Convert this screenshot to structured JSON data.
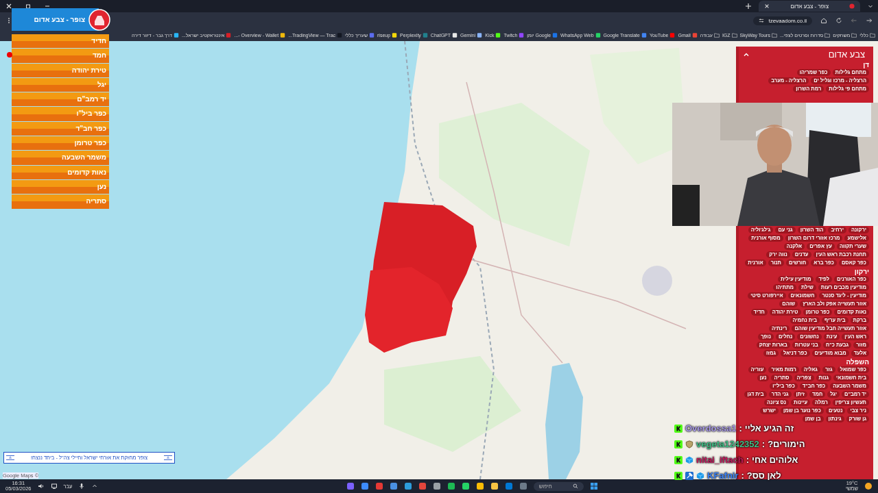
{
  "window": {
    "tab_title": "צופר - צבע אדום",
    "address": "tzevaadom.co.il"
  },
  "bookmarks": [
    {
      "label": "כללי",
      "kind": "folder"
    },
    {
      "label": "משחקים",
      "kind": "folder"
    },
    {
      "label": "סדרות וסרטים לצפי...",
      "kind": "folder"
    },
    {
      "label": "SkyWay Tours",
      "kind": "folder"
    },
    {
      "label": "IGZ",
      "kind": "folder"
    },
    {
      "label": "עבודה",
      "kind": "folder"
    },
    {
      "label": "Gmail",
      "kind": "site",
      "color": "#ea4335"
    },
    {
      "label": "YouTube",
      "kind": "site",
      "color": "#ff0000"
    },
    {
      "label": "Google Translate",
      "kind": "site",
      "color": "#4285f4"
    },
    {
      "label": "WhatsApp Web",
      "kind": "site",
      "color": "#25d366"
    },
    {
      "label": "Google יומן",
      "kind": "site",
      "color": "#1a73e8"
    },
    {
      "label": "Twitch",
      "kind": "site",
      "color": "#9146ff"
    },
    {
      "label": "Kick",
      "kind": "site",
      "color": "#53fc18"
    },
    {
      "label": "Gemini",
      "kind": "site",
      "color": "#8ab4f8"
    },
    {
      "label": "ChatGPT",
      "kind": "site",
      "color": "#e8e8e8"
    },
    {
      "label": "Perplexity",
      "kind": "site",
      "color": "#20808d"
    },
    {
      "label": "riseup",
      "kind": "site",
      "color": "#f5d90a"
    },
    {
      "label": "שעריך כללי",
      "kind": "site",
      "color": "#5b6cf0"
    },
    {
      "label": "TradingView — Trac...",
      "kind": "site",
      "color": "#131722"
    },
    {
      "label": "Overview - Wallet -...",
      "kind": "site",
      "color": "#f0b90b"
    },
    {
      "label": "אינטראקטיב ישראל...",
      "kind": "site",
      "color": "#d81f26"
    },
    {
      "label": "דרך גבר - דיוור דירה",
      "kind": "site",
      "color": "#29b6f6"
    }
  ],
  "app": {
    "title": "צופר - צבע אדום"
  },
  "alert_list": [
    "חדיד",
    "חמד",
    "טירת יהודה",
    "יגל",
    "יד רמב\"ם",
    "כפר ביל\"ו",
    "כפר חב\"ד",
    "כפר טרומן",
    "משמר השבעה",
    "נאות קדומים",
    "נען",
    "סתריה"
  ],
  "panel": {
    "title": "צבע אדום",
    "groups": [
      {
        "title": "דן",
        "tags": [
          "מתחם גלילות",
          "כפר שמריהו",
          "הרצליה - מרכז וגליל ים",
          "הרצליה - מערב",
          "מתחם פי גלילות",
          "רמת השרון"
        ]
      },
      {
        "tags": [
          "ירקונה",
          "ירחיב",
          "הוד השרון",
          "גני עם",
          "ג'לג'וליה",
          "אלישמע",
          "מרכז אזורי דרום השרון",
          "מסוף אורנית",
          "שערי תקווה",
          "עץ אפרים",
          "אלקנה",
          "תחנת רכבת ראש העין",
          "עדנים",
          "נווה ירק",
          "כפר קאסם",
          "כפר ברא",
          "חורשים",
          "תנור",
          "אורנית"
        ]
      },
      {
        "title": "ירקון",
        "tags": [
          "כפר האורנים",
          "לפיד",
          "מודיעין עילית",
          "מודיעין מכבים רעות",
          "שילת",
          "מתתיהו",
          "מודיעין - ליגד סנטר",
          "חשמונאים",
          "איירפורט סיטי",
          "אזור תעשייה אפק ולב הארץ",
          "שוהם",
          "נאות קדומים",
          "כפר טרומן",
          "טירת יהודה",
          "חדיד",
          "ברקת",
          "בית עריף",
          "בית נחמיה",
          "אזור תעשייה חבל מודיעין שוהם",
          "רינתיה",
          "ראש העין",
          "עינת",
          "נחשונים",
          "נחלים",
          "נופך",
          "מזור",
          "גבעת כ\"ח",
          "בני עטרות",
          "בארות יצחק",
          "אלעד",
          "מבוא מודיעים",
          "כפר דניאל",
          "גמזו"
        ]
      },
      {
        "title": "השפלה",
        "tags": [
          "כפר שמואל",
          "גזר",
          "גאליה",
          "רמות מאיר",
          "עזריה",
          "בית חשמונאי",
          "גנות",
          "צפריה",
          "סתריה",
          "נען",
          "משמר השבעה",
          "כפר חב\"ד",
          "כפר ביל\"ו",
          "יד רמב\"ם",
          "יגל",
          "חמד",
          "זיתן",
          "גני הדר",
          "בית דגן",
          "תעשיון צריפין",
          "רמלה",
          "עיינות",
          "נס ציונה",
          "ניר צבי",
          "נטעים",
          "כפר נוער בן שמן",
          "ישרש",
          "גן שורק",
          "גינתון",
          "בן שמן"
        ]
      }
    ]
  },
  "chat": [
    {
      "user": "Overdossa1",
      "color": "#a99ae8",
      "badges": [
        {
          "kind": "kick"
        }
      ],
      "separator": ":",
      "message": "זה הגיע אליי"
    },
    {
      "user": "vegeta1242352",
      "color": "#3fbf86",
      "badges": [
        {
          "kind": "kick"
        },
        {
          "kind": "shield"
        }
      ],
      "separator": ":",
      "message": "הימורים?"
    },
    {
      "user": "nitai_iftach",
      "color": "#c2185b",
      "badges": [
        {
          "kind": "kick"
        },
        {
          "kind": "cube"
        }
      ],
      "separator": ":",
      "message": "אלוהים אחי"
    },
    {
      "user": "KFafnir",
      "color": "#3b82f6",
      "badges": [
        {
          "kind": "kick"
        },
        {
          "kind": "hammer"
        },
        {
          "kind": "cube"
        }
      ],
      "separator": ":",
      "message": "לאן סס?"
    }
  ],
  "banner": "צופר מחזקת את אזרחי ישראל וחיילי צה\"ל - ביחד ננצח!",
  "map_credit": "Google Maps ©",
  "taskbar": {
    "time": "16:31",
    "date": "05/03/2026",
    "language": "עבר",
    "search_placeholder": "חיפוש",
    "temperature": "19°C",
    "weather": "שמשי"
  }
}
